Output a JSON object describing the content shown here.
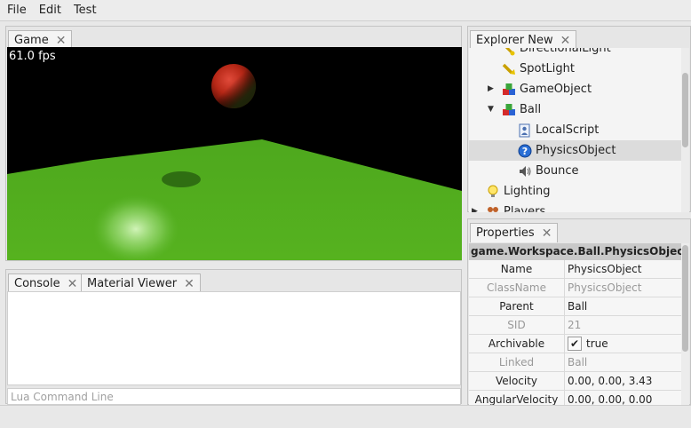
{
  "menu": [
    "File",
    "Edit",
    "Test"
  ],
  "game_tab": {
    "label": "Game",
    "close": "✕"
  },
  "viewport": {
    "fps": "61.0 fps"
  },
  "console_tabs": [
    {
      "label": "Console",
      "close": "✕"
    },
    {
      "label": "Material Viewer",
      "close": "✕"
    }
  ],
  "command_line": {
    "placeholder": "Lua Command Line"
  },
  "explorer": {
    "tab": {
      "label": "Explorer New",
      "close": "✕"
    },
    "items": [
      {
        "label": "DirectionalLight",
        "icon": "directional-light-icon",
        "expander": ""
      },
      {
        "label": "SpotLight",
        "icon": "spotlight-icon",
        "expander": ""
      },
      {
        "label": "GameObject",
        "icon": "gameobject-icon",
        "expander": "▶"
      },
      {
        "label": "Ball",
        "icon": "gameobject-icon",
        "expander": "▼"
      },
      {
        "label": "LocalScript",
        "icon": "script-icon",
        "expander": ""
      },
      {
        "label": "PhysicsObject",
        "icon": "physics-icon",
        "expander": "",
        "selected": true
      },
      {
        "label": "Bounce",
        "icon": "sound-icon",
        "expander": ""
      },
      {
        "label": "Lighting",
        "icon": "lightbulb-icon",
        "expander": ""
      },
      {
        "label": "Players",
        "icon": "players-icon",
        "expander": "▶"
      }
    ]
  },
  "properties": {
    "tab": {
      "label": "Properties",
      "close": "✕"
    },
    "path": "game.Workspace.Ball.PhysicsObject",
    "rows": [
      {
        "name": "Name",
        "value": "PhysicsObject",
        "dim": false
      },
      {
        "name": "ClassName",
        "value": "PhysicsObject",
        "dim": true
      },
      {
        "name": "Parent",
        "value": "Ball",
        "dim": false
      },
      {
        "name": "SID",
        "value": "21",
        "dim": true
      },
      {
        "name": "Archivable",
        "value": "true",
        "dim": false,
        "checkbox": true
      },
      {
        "name": "Linked",
        "value": "Ball",
        "dim": true
      },
      {
        "name": "Velocity",
        "value": "0.00, 0.00, 3.43",
        "dim": false
      },
      {
        "name": "AngularVelocity",
        "value": "0.00, 0.00, 0.00",
        "dim": false
      }
    ]
  }
}
